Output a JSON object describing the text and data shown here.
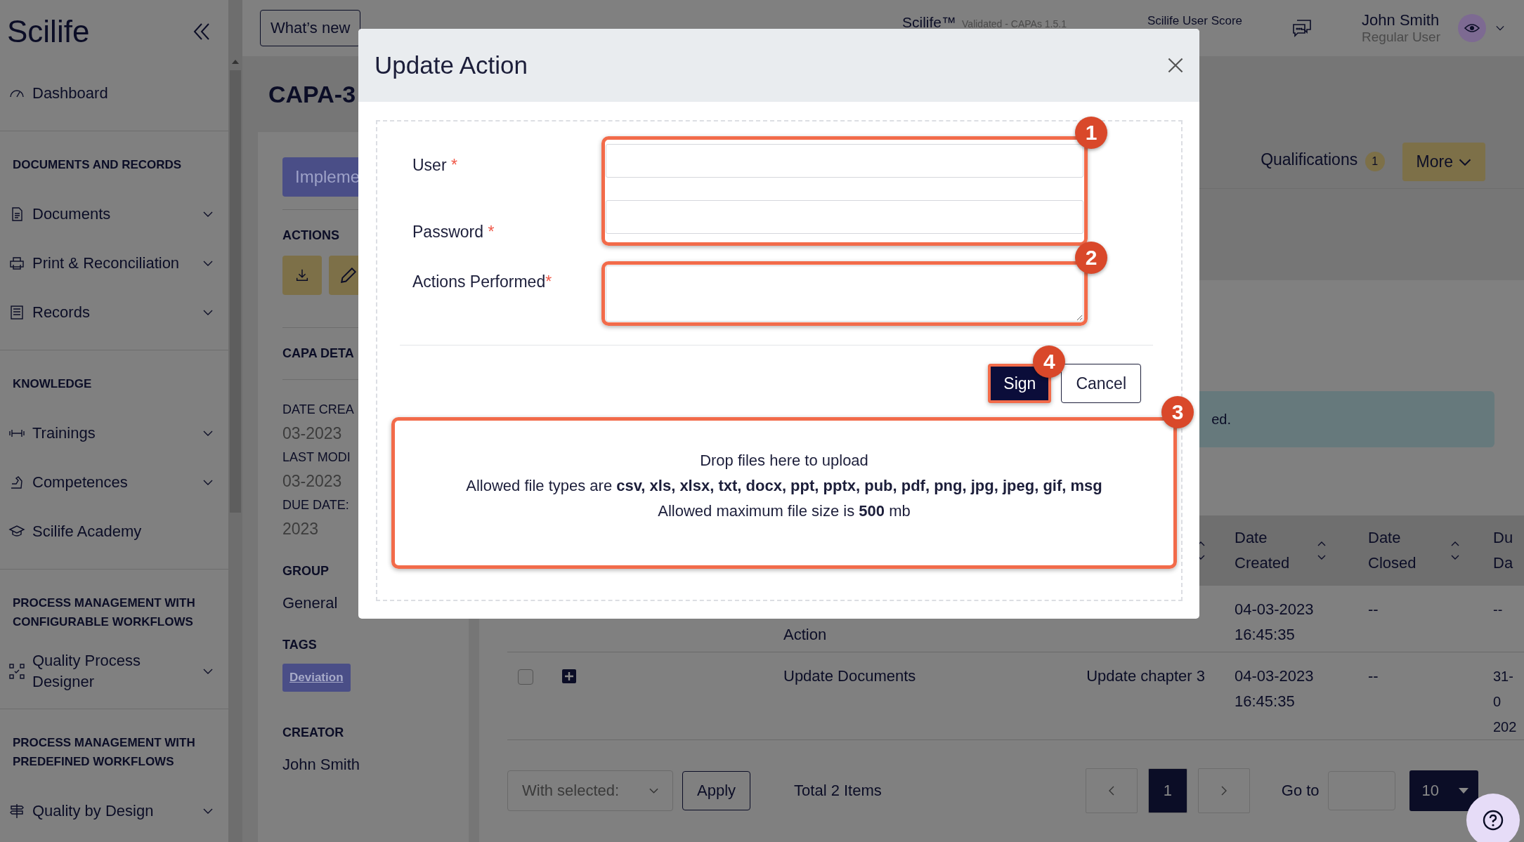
{
  "sidebar": {
    "logo": "Scilife",
    "sections": [
      {
        "items": [
          {
            "label": "Dashboard",
            "expandable": false
          }
        ]
      },
      {
        "heading": "DOCUMENTS AND RECORDS",
        "items": [
          {
            "label": "Documents",
            "expandable": true
          },
          {
            "label": "Print & Reconciliation",
            "expandable": true
          },
          {
            "label": "Records",
            "expandable": true
          }
        ]
      },
      {
        "heading": "KNOWLEDGE",
        "items": [
          {
            "label": "Trainings",
            "expandable": true
          },
          {
            "label": "Competences",
            "expandable": true
          },
          {
            "label": "Scilife Academy",
            "expandable": false
          }
        ]
      },
      {
        "heading": "PROCESS MANAGEMENT WITH CONFIGURABLE WORKFLOWS",
        "items": [
          {
            "label": "Quality Process Designer",
            "expandable": true
          }
        ]
      },
      {
        "heading": "PROCESS MANAGEMENT WITH PREDEFINED WORKFLOWS",
        "items": [
          {
            "label": "Quality by Design",
            "expandable": true
          }
        ]
      }
    ]
  },
  "top_bar": {
    "whats_new": "What’s new",
    "app_name": "Scilife™",
    "app_version": "Validated - CAPAs 1.5.1",
    "score_label": "Scilife User Score",
    "user_name": "John Smith",
    "user_role": "Regular User"
  },
  "record": {
    "title": "CAPA-3",
    "status_button": "Impleme",
    "actions_heading": "ACTIONS",
    "details_heading": "CAPA DETA",
    "details": [
      {
        "label": "DATE CREA",
        "value": "03-2023"
      },
      {
        "label": "LAST MODI",
        "value": "03-2023"
      },
      {
        "label": "DUE DATE:",
        "value": "2023"
      }
    ],
    "group_heading": "GROUP",
    "group": "General",
    "tags_heading": "TAGS",
    "tags": [
      "Deviation"
    ],
    "creator_heading": "CREATOR",
    "creator": "John Smith"
  },
  "tabs": [
    {
      "label": "Qualifications",
      "count": "1",
      "selected": false
    }
  ],
  "more_button": "More",
  "banner": {
    "text": "ed."
  },
  "table": {
    "columns": [
      {
        "label": "Date Created",
        "sortable": true
      },
      {
        "label": "Date Closed",
        "sortable": true
      },
      {
        "label": "Du Da"
      }
    ],
    "rows": [
      {
        "name": "Action",
        "created": "04-03-2023 16:45:35",
        "closed": "--",
        "due": "--"
      },
      {
        "checked": false,
        "expandable": true,
        "name": "Update Documents",
        "description": "Update chapter 3",
        "created": "04-03-2023 16:45:35",
        "closed": "--",
        "due": "31-0 202"
      }
    ]
  },
  "footer": {
    "bulk_select": "With selected:",
    "apply": "Apply",
    "total": "Total 2 Items",
    "pages": [
      {
        "label": "1",
        "selected": true
      }
    ],
    "goto_label": "Go to",
    "page_size": "10"
  },
  "modal": {
    "title": "Update Action",
    "login_fields": [
      {
        "label": "User",
        "required_mark": "*"
      },
      {
        "label": "Password",
        "required_mark": "*"
      }
    ],
    "actions_field": {
      "label": "Actions Performed",
      "required_mark": "*"
    },
    "buttons": [
      {
        "label": "Sign",
        "kind": "primary"
      },
      {
        "label": "Cancel",
        "kind": "secondary"
      }
    ],
    "dropzone": {
      "title": "Drop files here to upload",
      "types": "Allowed file types are **csv, xls, xlsx, txt, docx, ppt, pptx, pub, pdf, png, jpg, jpeg, gif, msg**",
      "size": "Allowed maximum file size is **500** mb"
    }
  },
  "annotations": [
    {
      "number": "1"
    },
    {
      "number": "2"
    },
    {
      "number": "3"
    },
    {
      "number": "4"
    }
  ]
}
